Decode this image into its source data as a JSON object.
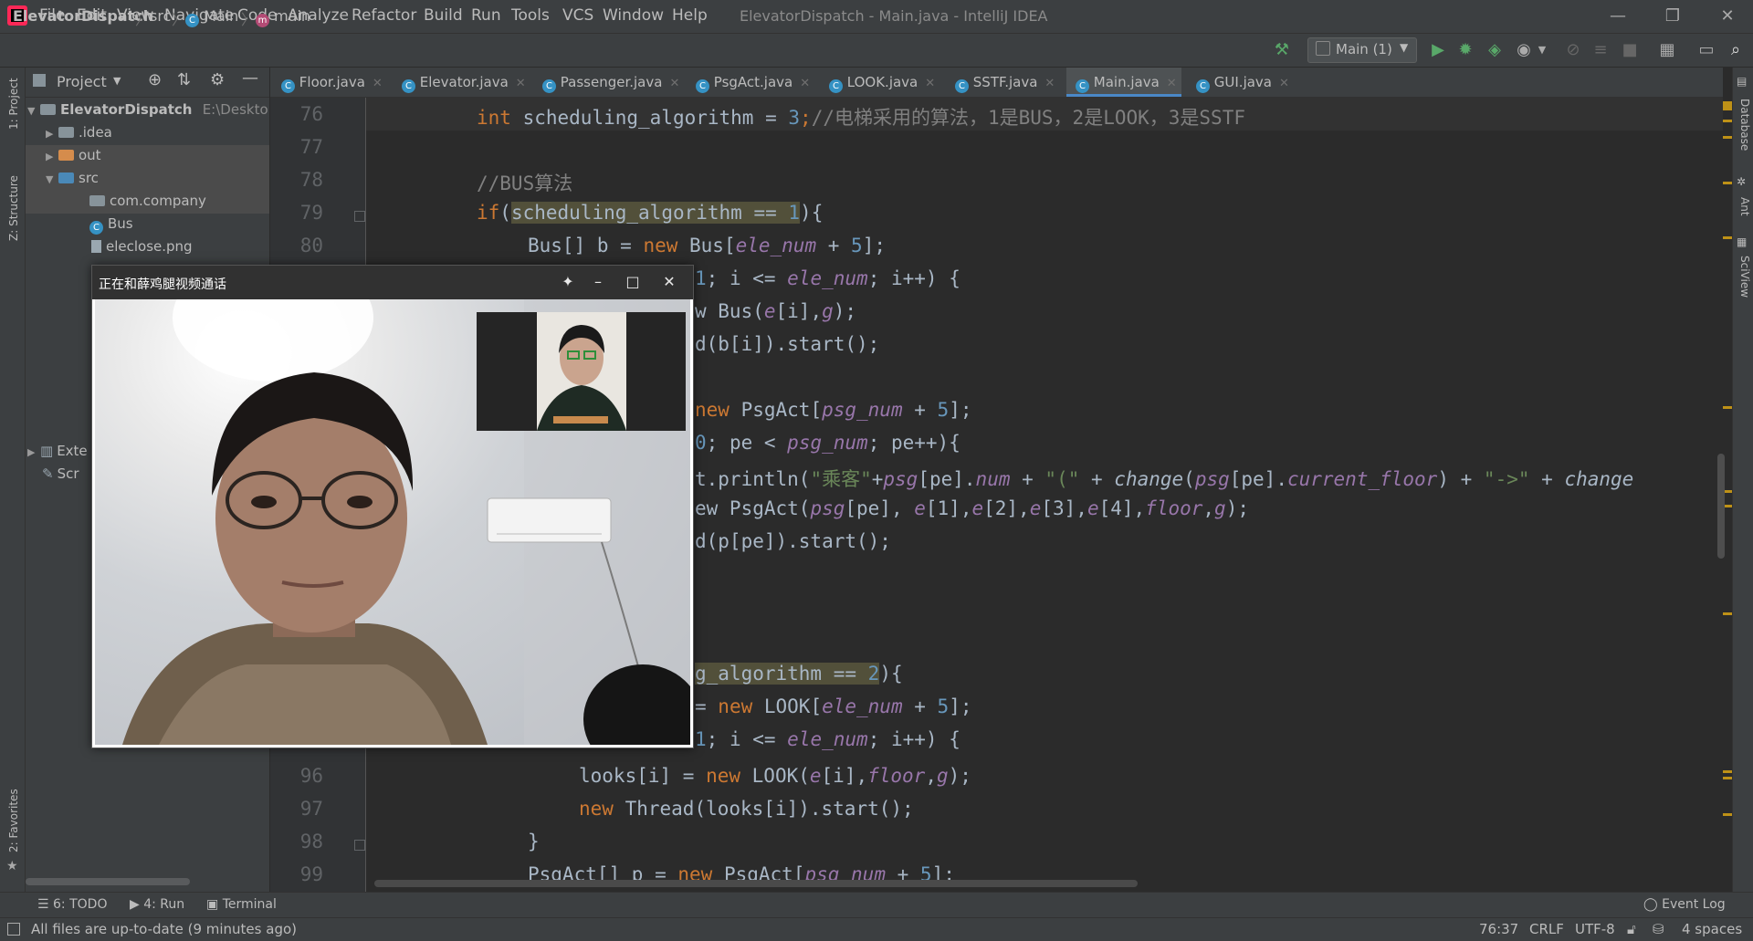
{
  "menu": [
    "File",
    "Edit",
    "View",
    "Navigate",
    "Code",
    "Analyze",
    "Refactor",
    "Build",
    "Run",
    "Tools",
    "VCS",
    "Window",
    "Help"
  ],
  "window_title": "ElevatorDispatch - Main.java - IntelliJ IDEA",
  "breadcrumb": {
    "project": "ElevatorDispatch",
    "folder": "src",
    "class": "Main",
    "method": "main"
  },
  "run_config": "Main (1)",
  "left_strip": {
    "project": "1: Project",
    "structure": "Z: Structure",
    "favorites": "2: Favorites"
  },
  "right_strip": {
    "database": "Database",
    "ant": "Ant",
    "sciview": "SciView"
  },
  "project_panel": {
    "title": "Project",
    "root": "ElevatorDispatch",
    "root_path": "E:\\Desktop\\",
    "items": [
      ".idea",
      "out",
      "src",
      "com.company",
      "Bus",
      "eleclose.png"
    ],
    "partial_items": [
      "Exte",
      "Scr"
    ]
  },
  "tabs": [
    "Floor.java",
    "Elevator.java",
    "Passenger.java",
    "PsgAct.java",
    "LOOK.java",
    "SSTF.java",
    "Main.java",
    "GUI.java"
  ],
  "line_numbers": {
    "l76": "76",
    "l77": "77",
    "l78": "78",
    "l79": "79",
    "l80": "80",
    "l96": "96",
    "l97": "97",
    "l98": "98",
    "l99": "99"
  },
  "code": {
    "l76_kw": "int",
    "l76_a": " scheduling_algorithm = ",
    "l76_num": "3",
    "l76_semi": ";",
    "l76_cm": "//电梯采用的算法，1是BUS，2是LOOK，3是SSTF",
    "l78_cm": "//BUS算法",
    "l79_kw": "if",
    "l79_a": "(",
    "l79_hl": "scheduling_algorithm == ",
    "l79_num": "1",
    "l79_b": "){",
    "l80_a": "Bus[] b = ",
    "l80_kw": "new",
    "l80_b": " Bus[",
    "l80_fld": "ele_num",
    "l80_c": " + ",
    "l80_num": "5",
    "l80_d": "];",
    "l81_num": "1",
    "l81_a": "; i <= ",
    "l81_fld": "ele_num",
    "l81_b": "; i++) {",
    "l82_a": "w Bus(",
    "l82_fld": "e",
    "l82_b": "[i],",
    "l82_fld2": "g",
    "l82_c": ");",
    "l83_a": "d(b[i]).start();",
    "l85_kw": "new",
    "l85_a": " PsgAct[",
    "l85_fld": "psg_num",
    "l85_b": " + ",
    "l85_num": "5",
    "l85_c": "];",
    "l86_num": "0",
    "l86_a": "; pe < ",
    "l86_fld": "psg_num",
    "l86_b": "; pe++){",
    "l87_a": "t.println(",
    "l87_str": "\"乘客\"",
    "l87_b": "+",
    "l87_fld": "psg",
    "l87_c": "[pe].",
    "l87_fld2": "num",
    "l87_d": " + ",
    "l87_str2": "\"(\"",
    "l87_e": " + ",
    "l87_m": "change",
    "l87_f": "(",
    "l87_fld3": "psg",
    "l87_g": "[pe].",
    "l87_fld4": "current_floor",
    "l87_h": ") + ",
    "l87_str3": "\"->\"",
    "l87_i": " + ",
    "l87_m2": "change",
    "l88_a": "ew PsgAct(",
    "l88_fld": "psg",
    "l88_b": "[pe], ",
    "l88_fld2": "e",
    "l88_c": "[1],",
    "l88_fld3": "e",
    "l88_d": "[2],",
    "l88_fld4": "e",
    "l88_e": "[3],",
    "l88_fld5": "e",
    "l88_f": "[4],",
    "l88_fld6": "floor",
    "l88_g": ",",
    "l88_fld7": "g",
    "l88_h": ");",
    "l89_a": "d(p[pe]).start();",
    "l93_hl": "g_algorithm == ",
    "l93_num": "2",
    "l93_b": "){",
    "l94_a": "= ",
    "l94_kw": "new",
    "l94_b": " LOOK[",
    "l94_fld": "ele_num",
    "l94_c": " + ",
    "l94_num": "5",
    "l94_d": "];",
    "l95_num": "1",
    "l95_a": "; i <= ",
    "l95_fld": "ele_num",
    "l95_b": "; i++) {",
    "l96_a": "looks[i] = ",
    "l96_kw": "new",
    "l96_b": " LOOK(",
    "l96_fld": "e",
    "l96_c": "[i],",
    "l96_fld2": "floor",
    "l96_d": ",",
    "l96_fld3": "g",
    "l96_e": ");",
    "l97_kw": "new",
    "l97_a": " Thread(looks[i]).start();",
    "l98_a": "}",
    "l99_a": "PsgAct[] p = ",
    "l99_kw": "new",
    "l99_b": " PsgAct[",
    "l99_fld": "psg_num",
    "l99_c": " + ",
    "l99_num": "5",
    "l99_d": "];"
  },
  "video_call": {
    "title": "正在和薛鸡腿视频通话"
  },
  "bottom_tools": {
    "todo": "6: TODO",
    "run": "4: Run",
    "terminal": "Terminal",
    "event_log": "Event Log"
  },
  "status": {
    "message": "All files are up-to-date (9 minutes ago)",
    "position": "76:37",
    "line_sep": "CRLF",
    "encoding": "UTF-8",
    "indent": "4 spaces"
  },
  "colors": {
    "keyword": "#cc7832",
    "number": "#6897bb",
    "field": "#9876aa",
    "string": "#6a8759",
    "comment": "#808080",
    "accent": "#4a88c7"
  }
}
